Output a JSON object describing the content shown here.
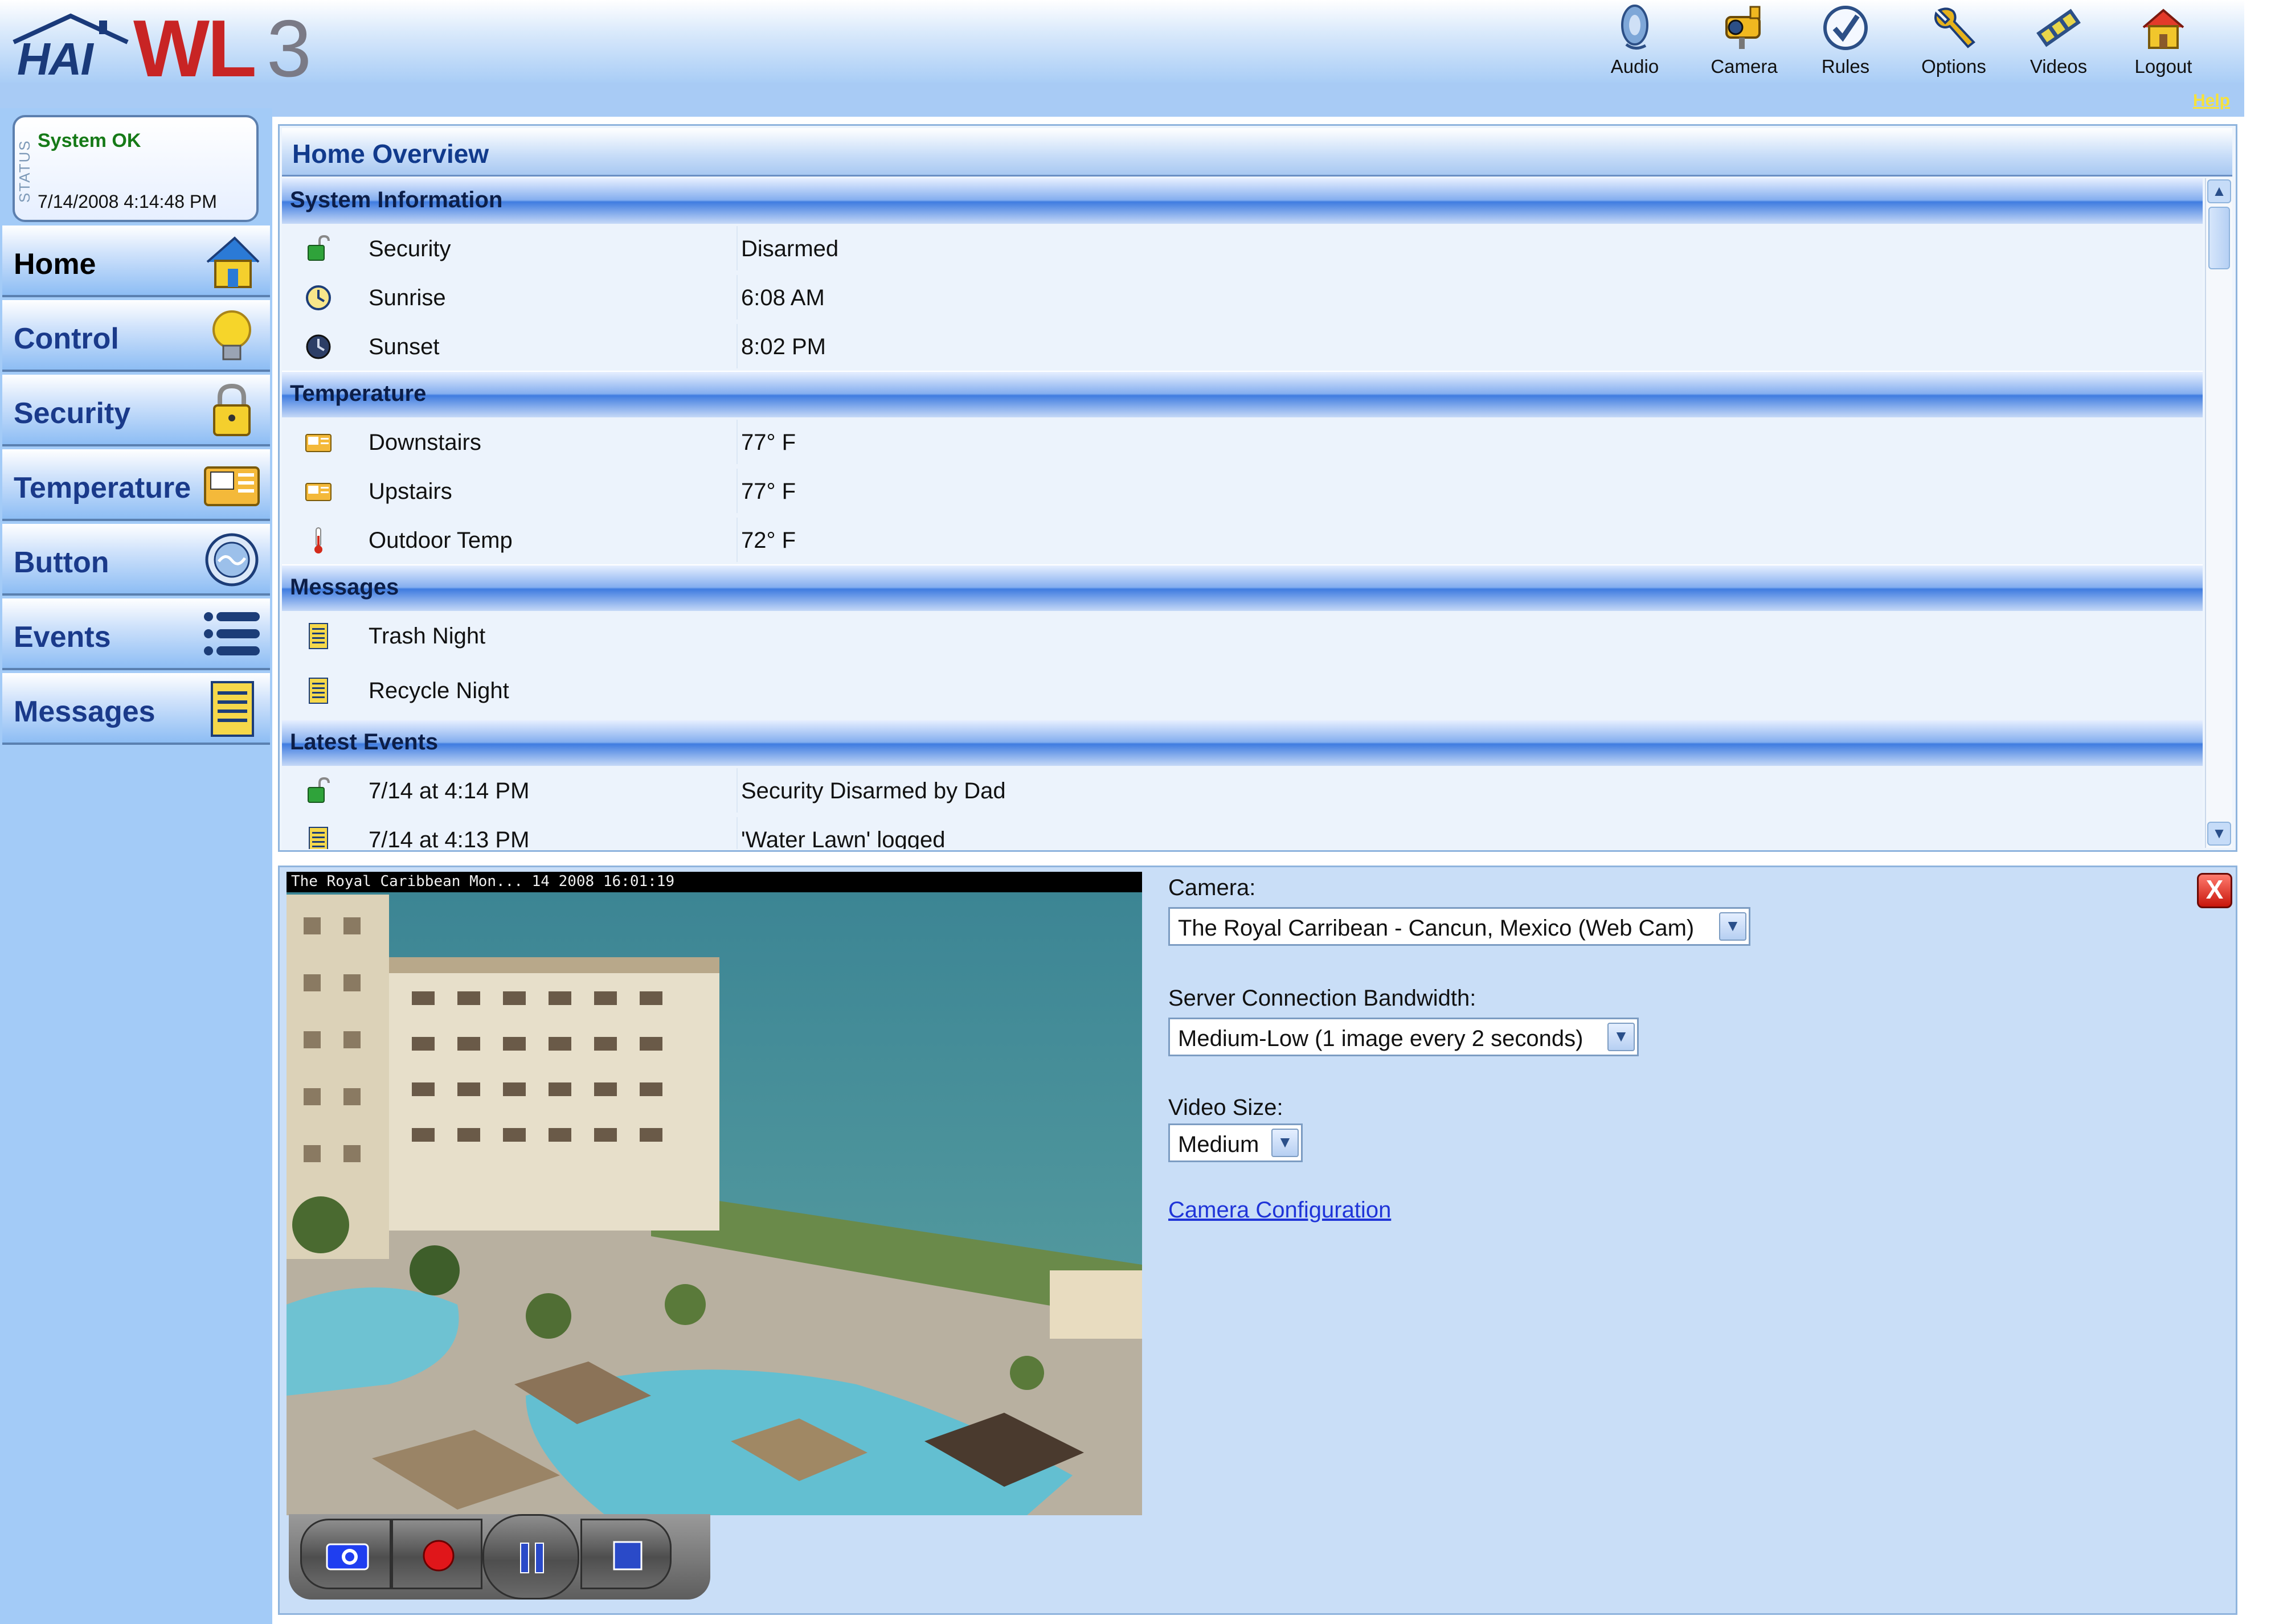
{
  "app": {
    "logo_left": "HAI",
    "logo_wl": "WL",
    "logo_3": "3"
  },
  "toolbar": {
    "items": [
      {
        "label": "Audio",
        "icon": "speaker-icon"
      },
      {
        "label": "Camera",
        "icon": "camera-icon"
      },
      {
        "label": "Rules",
        "icon": "checkmark-icon"
      },
      {
        "label": "Options",
        "icon": "wrench-icon"
      },
      {
        "label": "Videos",
        "icon": "film-icon"
      },
      {
        "label": "Logout",
        "icon": "house-exit-icon"
      }
    ],
    "help": "Help"
  },
  "status": {
    "vertical_label": "STATUS",
    "text": "System OK",
    "datetime": "7/14/2008 4:14:48 PM"
  },
  "sidebar": {
    "items": [
      {
        "label": "Home",
        "icon": "house-icon",
        "active": true
      },
      {
        "label": "Control",
        "icon": "lightbulb-icon"
      },
      {
        "label": "Security",
        "icon": "padlock-icon"
      },
      {
        "label": "Temperature",
        "icon": "thermostat-icon"
      },
      {
        "label": "Button",
        "icon": "round-button-icon"
      },
      {
        "label": "Events",
        "icon": "list-icon"
      },
      {
        "label": "Messages",
        "icon": "document-icon"
      }
    ]
  },
  "overview": {
    "title": "Home Overview",
    "sections": {
      "system": {
        "title": "System Information",
        "rows": [
          {
            "label": "Security",
            "value": "Disarmed",
            "icon": "unlocked-padlock-icon"
          },
          {
            "label": "Sunrise",
            "value": "6:08 AM",
            "icon": "clock-icon"
          },
          {
            "label": "Sunset",
            "value": "8:02 PM",
            "icon": "moon-clock-icon"
          }
        ]
      },
      "temperature": {
        "title": "Temperature",
        "rows": [
          {
            "label": "Downstairs",
            "value": "77° F",
            "icon": "thermostat-icon"
          },
          {
            "label": "Upstairs",
            "value": "77° F",
            "icon": "thermostat-icon"
          },
          {
            "label": "Outdoor Temp",
            "value": "72° F",
            "icon": "thermometer-icon"
          }
        ]
      },
      "messages": {
        "title": "Messages",
        "rows": [
          {
            "label": "Trash Night",
            "icon": "document-icon"
          },
          {
            "label": "Recycle Night",
            "icon": "document-icon"
          }
        ]
      },
      "events": {
        "title": "Latest Events",
        "rows": [
          {
            "label": "7/14 at 4:14 PM",
            "value": "Security Disarmed by Dad",
            "icon": "unlocked-padlock-icon"
          },
          {
            "label": "7/14 at 4:13 PM",
            "value": "'Water Lawn' logged",
            "icon": "document-icon"
          }
        ]
      }
    }
  },
  "camera": {
    "caption": "The Royal Caribbean Mon... 14 2008 16:01:19",
    "camera_label": "Camera:",
    "camera_value": "The Royal Carribean - Cancun, Mexico (Web Cam)",
    "bandwidth_label": "Server Connection Bandwidth:",
    "bandwidth_value": "Medium-Low (1 image every 2 seconds)",
    "size_label": "Video Size:",
    "size_value": "Medium",
    "config_link": "Camera Configuration",
    "controls": [
      "snapshot-icon",
      "record-icon",
      "pause-icon",
      "stop-icon"
    ],
    "close_glyph": "X"
  },
  "colors": {
    "brand_red": "#c82424",
    "brand_navy": "#1a3a7a",
    "status_green": "#167a18",
    "sidebar_bg": "#a3cbf7",
    "section_blue": "#3f7ce0",
    "link": "#1f34d8",
    "help_yellow": "#f7e23a"
  }
}
